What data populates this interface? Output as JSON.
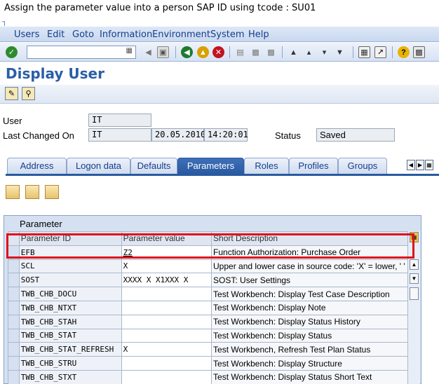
{
  "caption": "Assign the parameter value into a  person SAP ID using tcode : SU01",
  "menu": [
    {
      "label": "Users"
    },
    {
      "label": "Edit"
    },
    {
      "label": "Goto"
    },
    {
      "label": "Information"
    },
    {
      "label": "Environment"
    },
    {
      "label": "System"
    },
    {
      "label": "Help"
    }
  ],
  "command_field": {
    "value": ""
  },
  "page_title": "Display User",
  "fields": {
    "user_label": "User",
    "user_value": "IT",
    "last_changed_label": "Last Changed On",
    "last_changed_value": "IT",
    "date_value": "20.05.2010",
    "time_value": "14:20:01",
    "status_label": "Status",
    "status_value": "Saved"
  },
  "tabs": [
    {
      "label": "Address"
    },
    {
      "label": "Logon data"
    },
    {
      "label": "Defaults"
    },
    {
      "label": "Parameters"
    },
    {
      "label": "Roles"
    },
    {
      "label": "Profiles"
    },
    {
      "label": "Groups"
    }
  ],
  "active_tab": "Parameters",
  "panel_title": "Parameter",
  "table": {
    "columns": [
      "Parameter ID",
      "Parameter value",
      "Short Description"
    ],
    "rows": [
      {
        "id": "EFB",
        "value": "Z2",
        "desc": "Function Authorization: Purchase Order"
      },
      {
        "id": "SCL",
        "value": "X",
        "desc": "Upper and lower case in source code: 'X' = lower, ' '"
      },
      {
        "id": "SOST",
        "value": "XXXX  X X1XXX   X",
        "desc": "SOST: User Settings"
      },
      {
        "id": "TWB_CHB_DOCU",
        "value": "",
        "desc": "Test Workbench: Display Test Case Description"
      },
      {
        "id": "TWB_CHB_NTXT",
        "value": "",
        "desc": "Test Workbench: Display Note"
      },
      {
        "id": "TWB_CHB_STAH",
        "value": "",
        "desc": "Test Workbench: Display Status History"
      },
      {
        "id": "TWB_CHB_STAT",
        "value": "",
        "desc": "Test Workbench: Display Status"
      },
      {
        "id": "TWB_CHB_STAT_REFRESH",
        "value": "X",
        "desc": "Test Workbench, Refresh Test Plan Status"
      },
      {
        "id": "TWB_CHB_STRU",
        "value": "",
        "desc": "Test Workbench: Display Structure"
      },
      {
        "id": "TWB_CHB_STXT",
        "value": "",
        "desc": "Test Workbench: Display Status Short Text"
      }
    ]
  },
  "colors": {
    "accent": "#2a5fa6",
    "highlight": "#e0101c"
  },
  "icons": [
    "enter-icon",
    "back-icon",
    "save-icon",
    "green-back-icon",
    "exit-icon",
    "cancel-icon",
    "print-icon",
    "find-icon",
    "find-next-icon",
    "first-page-icon",
    "prev-page-icon",
    "next-page-icon",
    "last-page-icon",
    "create-session-icon",
    "shortcut-icon",
    "help-icon",
    "layout-icon",
    "change-icon",
    "display-icon"
  ]
}
